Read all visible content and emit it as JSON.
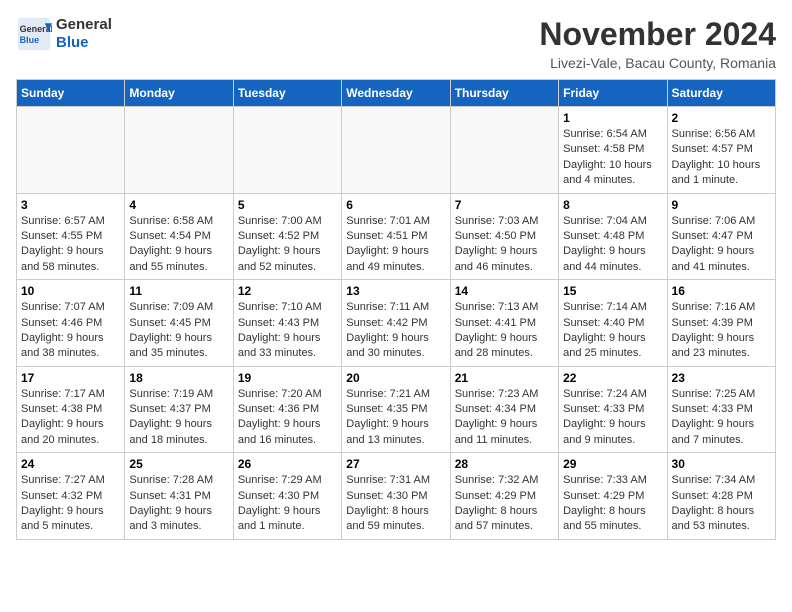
{
  "logo": {
    "line1": "General",
    "line2": "Blue"
  },
  "title": "November 2024",
  "location": "Livezi-Vale, Bacau County, Romania",
  "weekdays": [
    "Sunday",
    "Monday",
    "Tuesday",
    "Wednesday",
    "Thursday",
    "Friday",
    "Saturday"
  ],
  "weeks": [
    [
      {
        "day": "",
        "info": ""
      },
      {
        "day": "",
        "info": ""
      },
      {
        "day": "",
        "info": ""
      },
      {
        "day": "",
        "info": ""
      },
      {
        "day": "",
        "info": ""
      },
      {
        "day": "1",
        "info": "Sunrise: 6:54 AM\nSunset: 4:58 PM\nDaylight: 10 hours and 4 minutes."
      },
      {
        "day": "2",
        "info": "Sunrise: 6:56 AM\nSunset: 4:57 PM\nDaylight: 10 hours and 1 minute."
      }
    ],
    [
      {
        "day": "3",
        "info": "Sunrise: 6:57 AM\nSunset: 4:55 PM\nDaylight: 9 hours and 58 minutes."
      },
      {
        "day": "4",
        "info": "Sunrise: 6:58 AM\nSunset: 4:54 PM\nDaylight: 9 hours and 55 minutes."
      },
      {
        "day": "5",
        "info": "Sunrise: 7:00 AM\nSunset: 4:52 PM\nDaylight: 9 hours and 52 minutes."
      },
      {
        "day": "6",
        "info": "Sunrise: 7:01 AM\nSunset: 4:51 PM\nDaylight: 9 hours and 49 minutes."
      },
      {
        "day": "7",
        "info": "Sunrise: 7:03 AM\nSunset: 4:50 PM\nDaylight: 9 hours and 46 minutes."
      },
      {
        "day": "8",
        "info": "Sunrise: 7:04 AM\nSunset: 4:48 PM\nDaylight: 9 hours and 44 minutes."
      },
      {
        "day": "9",
        "info": "Sunrise: 7:06 AM\nSunset: 4:47 PM\nDaylight: 9 hours and 41 minutes."
      }
    ],
    [
      {
        "day": "10",
        "info": "Sunrise: 7:07 AM\nSunset: 4:46 PM\nDaylight: 9 hours and 38 minutes."
      },
      {
        "day": "11",
        "info": "Sunrise: 7:09 AM\nSunset: 4:45 PM\nDaylight: 9 hours and 35 minutes."
      },
      {
        "day": "12",
        "info": "Sunrise: 7:10 AM\nSunset: 4:43 PM\nDaylight: 9 hours and 33 minutes."
      },
      {
        "day": "13",
        "info": "Sunrise: 7:11 AM\nSunset: 4:42 PM\nDaylight: 9 hours and 30 minutes."
      },
      {
        "day": "14",
        "info": "Sunrise: 7:13 AM\nSunset: 4:41 PM\nDaylight: 9 hours and 28 minutes."
      },
      {
        "day": "15",
        "info": "Sunrise: 7:14 AM\nSunset: 4:40 PM\nDaylight: 9 hours and 25 minutes."
      },
      {
        "day": "16",
        "info": "Sunrise: 7:16 AM\nSunset: 4:39 PM\nDaylight: 9 hours and 23 minutes."
      }
    ],
    [
      {
        "day": "17",
        "info": "Sunrise: 7:17 AM\nSunset: 4:38 PM\nDaylight: 9 hours and 20 minutes."
      },
      {
        "day": "18",
        "info": "Sunrise: 7:19 AM\nSunset: 4:37 PM\nDaylight: 9 hours and 18 minutes."
      },
      {
        "day": "19",
        "info": "Sunrise: 7:20 AM\nSunset: 4:36 PM\nDaylight: 9 hours and 16 minutes."
      },
      {
        "day": "20",
        "info": "Sunrise: 7:21 AM\nSunset: 4:35 PM\nDaylight: 9 hours and 13 minutes."
      },
      {
        "day": "21",
        "info": "Sunrise: 7:23 AM\nSunset: 4:34 PM\nDaylight: 9 hours and 11 minutes."
      },
      {
        "day": "22",
        "info": "Sunrise: 7:24 AM\nSunset: 4:33 PM\nDaylight: 9 hours and 9 minutes."
      },
      {
        "day": "23",
        "info": "Sunrise: 7:25 AM\nSunset: 4:33 PM\nDaylight: 9 hours and 7 minutes."
      }
    ],
    [
      {
        "day": "24",
        "info": "Sunrise: 7:27 AM\nSunset: 4:32 PM\nDaylight: 9 hours and 5 minutes."
      },
      {
        "day": "25",
        "info": "Sunrise: 7:28 AM\nSunset: 4:31 PM\nDaylight: 9 hours and 3 minutes."
      },
      {
        "day": "26",
        "info": "Sunrise: 7:29 AM\nSunset: 4:30 PM\nDaylight: 9 hours and 1 minute."
      },
      {
        "day": "27",
        "info": "Sunrise: 7:31 AM\nSunset: 4:30 PM\nDaylight: 8 hours and 59 minutes."
      },
      {
        "day": "28",
        "info": "Sunrise: 7:32 AM\nSunset: 4:29 PM\nDaylight: 8 hours and 57 minutes."
      },
      {
        "day": "29",
        "info": "Sunrise: 7:33 AM\nSunset: 4:29 PM\nDaylight: 8 hours and 55 minutes."
      },
      {
        "day": "30",
        "info": "Sunrise: 7:34 AM\nSunset: 4:28 PM\nDaylight: 8 hours and 53 minutes."
      }
    ]
  ]
}
